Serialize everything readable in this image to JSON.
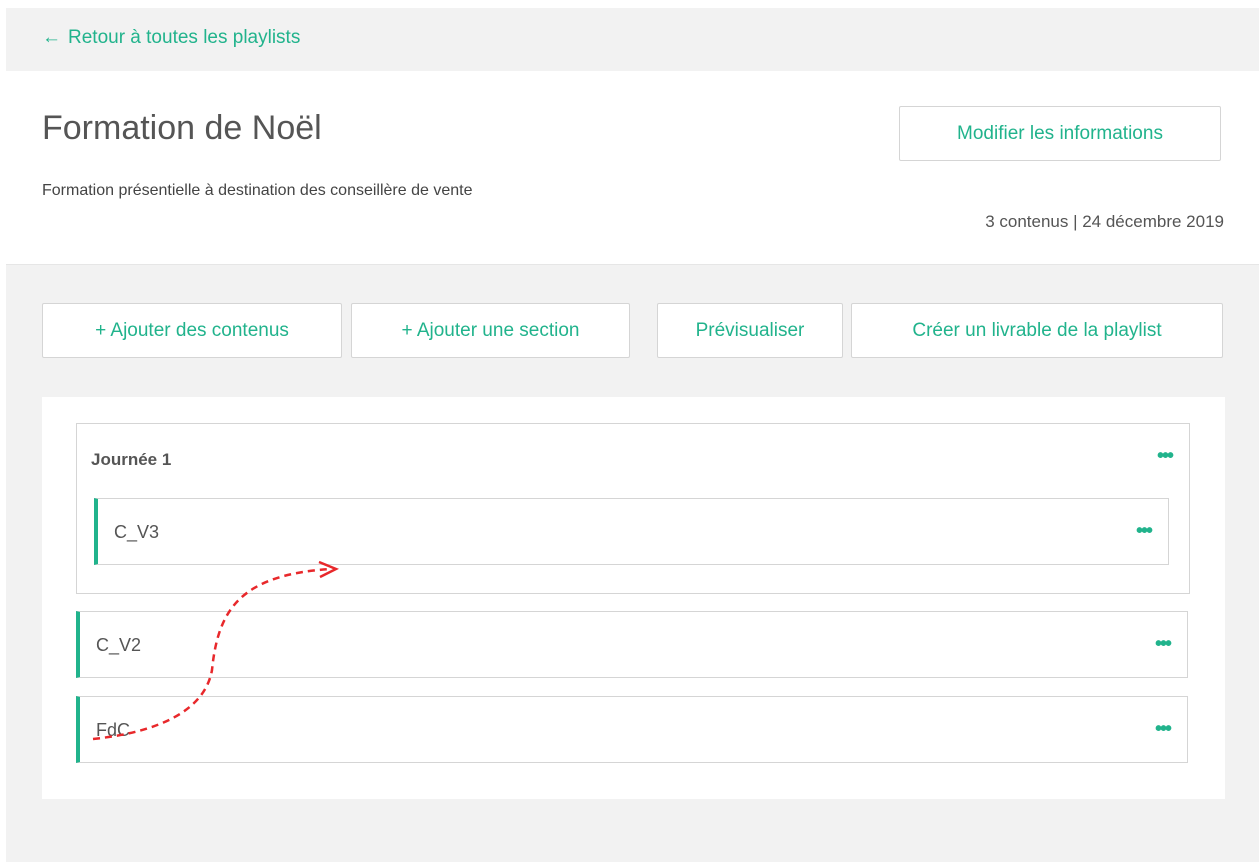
{
  "nav": {
    "back_label": "Retour à toutes les playlists"
  },
  "playlist": {
    "title": "Formation de Noël",
    "description": "Formation présentielle à destination des conseillère de vente",
    "edit_label": "Modifier les informations",
    "meta": "3 contenus | 24 décembre 2019"
  },
  "toolbar": {
    "add_contents": "+ Ajouter des contenus",
    "add_section": "+ Ajouter une section",
    "preview": "Prévisualiser",
    "create_deliverable": "Créer un livrable de la playlist"
  },
  "section": {
    "title": "Journée 1",
    "items": [
      {
        "label": "C_V3"
      }
    ]
  },
  "items": [
    {
      "label": "C_V2"
    },
    {
      "label": "FdC"
    }
  ],
  "icons": {
    "more": "more-dots-icon",
    "back": "arrow-left-icon"
  },
  "colors": {
    "accent": "#21b38c",
    "annotation": "#e8282b"
  }
}
